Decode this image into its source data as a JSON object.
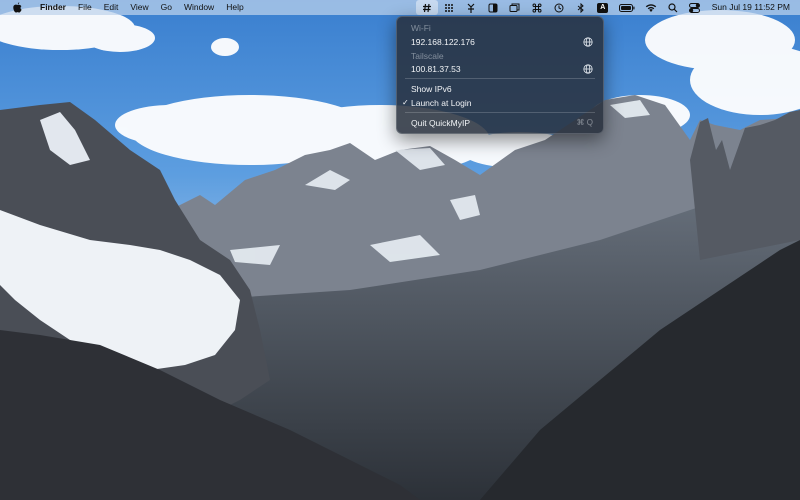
{
  "menubar": {
    "apple_icon": "apple-logo-icon",
    "app_name": "Finder",
    "items": [
      "File",
      "Edit",
      "View",
      "Go",
      "Window",
      "Help"
    ],
    "status_icons": [
      "hash-icon",
      "grid-dots-icon",
      "fork-icon",
      "contrast-icon",
      "windows-icon",
      "command-icon",
      "clock-history-icon",
      "bluetooth-icon",
      "input-source-icon",
      "battery-icon",
      "wifi-icon",
      "search-icon",
      "control-center-icon"
    ],
    "input_source_label": "A",
    "clock": "Sun Jul 19  11:52 PM"
  },
  "dropdown": {
    "wifi_header": "Wi-Fi",
    "wifi_ip": "192.168.122.176",
    "tailscale_header": "Tailscale",
    "tailscale_ip": "100.81.37.53",
    "show_ipv6": "Show IPv6",
    "launch_at_login": "Launch at Login",
    "launch_checked": "✓",
    "quit": "Quit QuickMyIP",
    "quit_shortcut": "⌘ Q"
  },
  "colors": {
    "menubar_bg": "#c4d6ec",
    "menu_bg": "#28303c",
    "sky": "#3f86d4"
  }
}
